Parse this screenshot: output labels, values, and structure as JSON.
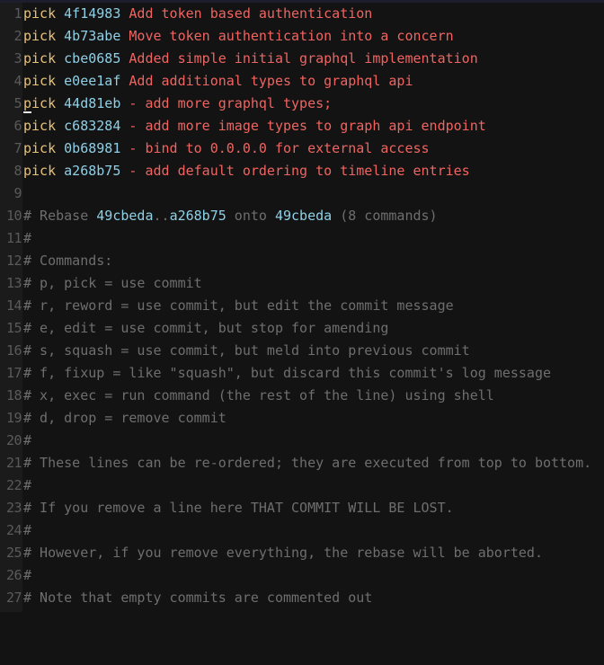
{
  "editor": {
    "theme_colors": {
      "background": "#131313",
      "gutter": "#1b1b1b",
      "keyword": "#e6c27a",
      "hash": "#8fd0e6",
      "message": "#ef6461",
      "comment": "#6e6e6e",
      "line_number": "#5a5a5a"
    },
    "cursor": {
      "line": 5,
      "column": 1
    },
    "picks": [
      {
        "n": "1",
        "cmd": "pick",
        "hash": "4f14983",
        "msg": "Add token based authentication"
      },
      {
        "n": "2",
        "cmd": "pick",
        "hash": "4b73abe",
        "msg": "Move token authentication into a concern"
      },
      {
        "n": "3",
        "cmd": "pick",
        "hash": "cbe0685",
        "msg": "Added simple initial graphql implementation"
      },
      {
        "n": "4",
        "cmd": "pick",
        "hash": "e0ee1af",
        "msg": "Add additional types to graphql api"
      },
      {
        "n": "5",
        "cmd": "pick",
        "hash": "44d81eb",
        "msg": "- add more graphql types;"
      },
      {
        "n": "6",
        "cmd": "pick",
        "hash": "c683284",
        "msg": "- add more image types to graph api endpoint"
      },
      {
        "n": "7",
        "cmd": "pick",
        "hash": "0b68981",
        "msg": "- bind to 0.0.0.0 for external access"
      },
      {
        "n": "8",
        "cmd": "pick",
        "hash": "a268b75",
        "msg": "- add default ordering to timeline entries"
      }
    ],
    "blank_line_9": "9",
    "rebase_line": {
      "n": "10",
      "prefix": "# Rebase ",
      "from": "49cbeda",
      "dots": "..",
      "to": "a268b75",
      "onto_label": " onto ",
      "onto": "49cbeda",
      "suffix": " (8 commands)"
    },
    "comments": [
      {
        "n": "11",
        "text": "#"
      },
      {
        "n": "12",
        "text": "# Commands:"
      },
      {
        "n": "13",
        "text": "# p, pick = use commit"
      },
      {
        "n": "14",
        "text": "# r, reword = use commit, but edit the commit message"
      },
      {
        "n": "15",
        "text": "# e, edit = use commit, but stop for amending"
      },
      {
        "n": "16",
        "text": "# s, squash = use commit, but meld into previous commit"
      },
      {
        "n": "17",
        "text": "# f, fixup = like \"squash\", but discard this commit's log message"
      },
      {
        "n": "18",
        "text": "# x, exec = run command (the rest of the line) using shell"
      },
      {
        "n": "19",
        "text": "# d, drop = remove commit"
      },
      {
        "n": "20",
        "text": "#"
      },
      {
        "n": "21",
        "text": "# These lines can be re-ordered; they are executed from top to bottom."
      },
      {
        "n": "22",
        "text": "#"
      },
      {
        "n": "23",
        "text": "# If you remove a line here THAT COMMIT WILL BE LOST."
      },
      {
        "n": "24",
        "text": "#"
      },
      {
        "n": "25",
        "text": "# However, if you remove everything, the rebase will be aborted."
      },
      {
        "n": "26",
        "text": "#"
      },
      {
        "n": "27",
        "text": "# Note that empty commits are commented out"
      }
    ]
  }
}
